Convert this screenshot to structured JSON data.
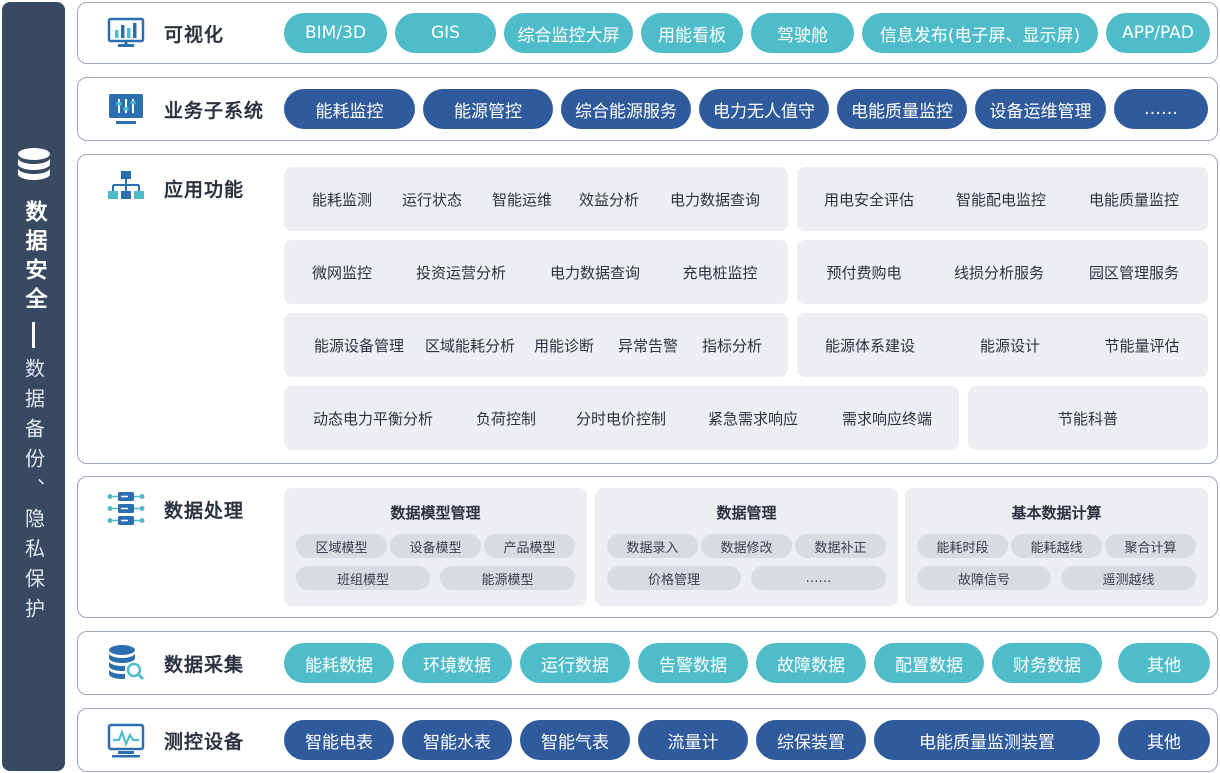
{
  "security": {
    "main": "数据安全",
    "sub": "数据备份、隐私保护"
  },
  "layers": {
    "visualization": {
      "title": "可视化",
      "items": [
        "BIM/3D",
        "GIS",
        "综合监控大屏",
        "用能看板",
        "驾驶舱",
        "信息发布(电子屏、显示屏)",
        "APP/PAD"
      ]
    },
    "business": {
      "title": "业务子系统",
      "items": [
        "能耗监控",
        "能源管控",
        "综合能源服务",
        "电力无人值守",
        "电能质量监控",
        "设备运维管理",
        "……"
      ]
    },
    "application": {
      "title": "应用功能",
      "rows": [
        {
          "left": [
            "能耗监测",
            "运行状态",
            "智能运维",
            "效益分析",
            "电力数据查询"
          ],
          "right": [
            "用电安全评估",
            "智能配电监控",
            "电能质量监控"
          ]
        },
        {
          "left": [
            "微网监控",
            "投资运营分析",
            "电力数据查询",
            "充电桩监控"
          ],
          "right": [
            "预付费购电",
            "线损分析服务",
            "园区管理服务"
          ]
        },
        {
          "left": [
            "能源设备管理",
            "区域能耗分析",
            "用能诊断",
            "异常告警",
            "指标分析"
          ],
          "right": [
            "能源体系建设",
            "能源设计",
            "节能量评估"
          ]
        },
        {
          "left": [
            "动态电力平衡分析",
            "负荷控制",
            "分时电价控制",
            "紧急需求响应",
            "需求响应终端"
          ],
          "right": [
            "节能科普"
          ]
        }
      ]
    },
    "processing": {
      "title": "数据处理",
      "groups": [
        {
          "title": "数据模型管理",
          "row1": [
            "区域模型",
            "设备模型",
            "产品模型"
          ],
          "row2": [
            "班组模型",
            "能源模型"
          ]
        },
        {
          "title": "数据管理",
          "row1": [
            "数据录入",
            "数据修改",
            "数据补正"
          ],
          "row2": [
            "价格管理",
            "……"
          ]
        },
        {
          "title": "基本数据计算",
          "row1": [
            "能耗时段",
            "能耗越线",
            "聚合计算"
          ],
          "row2": [
            "故障信号",
            "遥测越线"
          ]
        }
      ]
    },
    "collection": {
      "title": "数据采集",
      "items": [
        "能耗数据",
        "环境数据",
        "运行数据",
        "告警数据",
        "故障数据",
        "配置数据",
        "财务数据",
        "其他"
      ]
    },
    "devices": {
      "title": "测控设备",
      "items": [
        "智能电表",
        "智能水表",
        "智能气表",
        "流量计",
        "综保装置",
        "电能质量监测装置",
        "其他"
      ]
    }
  },
  "colors": {
    "navy": "#2f5b9c",
    "teal": "#4fbdc9",
    "sidebar": "#384a62",
    "panel": "#eceef1",
    "chip": "#d8dbe0",
    "icon": "#2b6fb1"
  }
}
